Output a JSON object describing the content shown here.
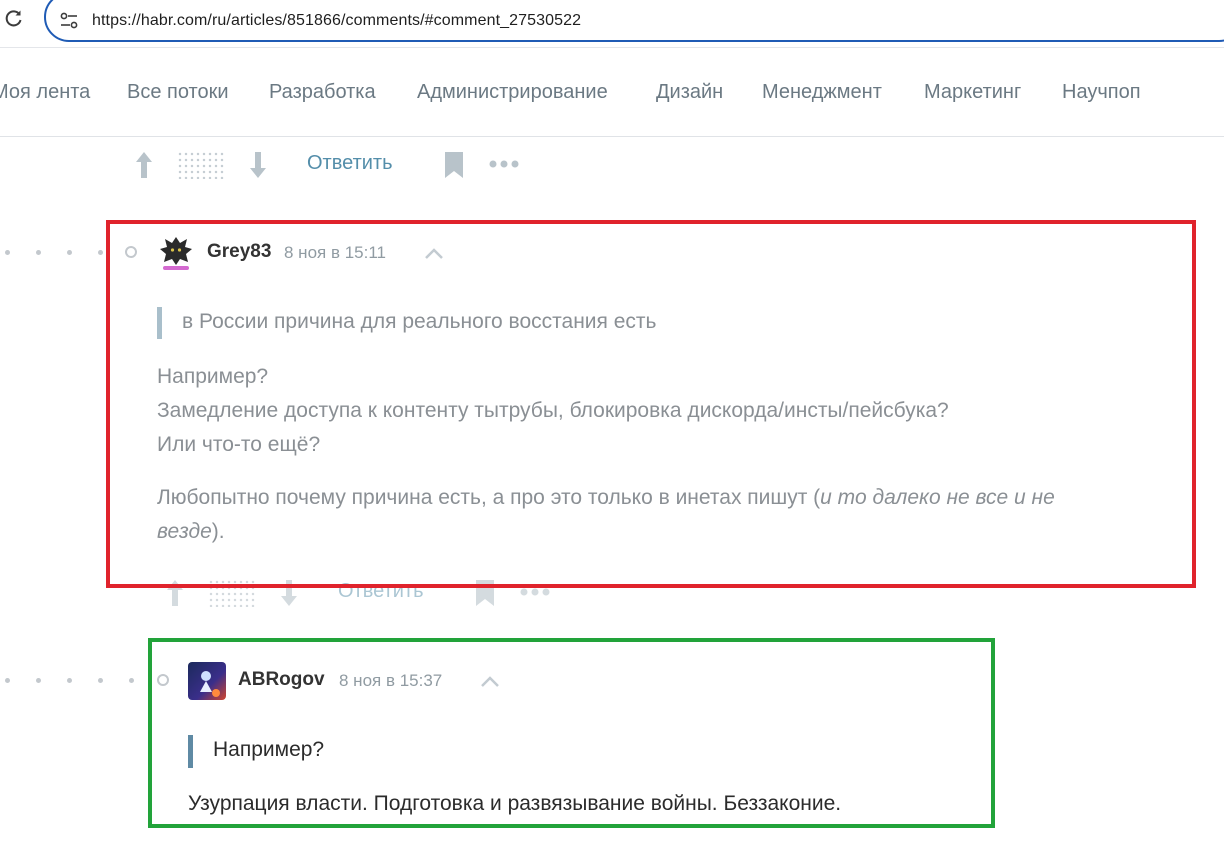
{
  "browser": {
    "url": "https://habr.com/ru/articles/851866/comments/#comment_27530522",
    "icons": {
      "reload": "reload-icon",
      "site_info": "site-info-icon"
    }
  },
  "nav": {
    "items": [
      "Моя лента",
      "Все потоки",
      "Разработка",
      "Администрирование",
      "Дизайн",
      "Менеджмент",
      "Маркетинг",
      "Научпоп"
    ]
  },
  "actions": {
    "reply_label": "Ответить",
    "icons": [
      "arrow-up-icon",
      "arrow-down-icon",
      "bookmark-icon",
      "more-icon"
    ]
  },
  "comments": [
    {
      "username": "Grey83",
      "date": "8 ноя в 15:11",
      "quote": "в России причина для реального восстания есть",
      "lines": [
        "Например?",
        "Замедление доступа к контенту тытрубы, блокировка дискорда/инсты/пейсбука?",
        "Или что-то ещё?"
      ],
      "paragraph": {
        "before": "Любопытно почему причина есть, а про это только в инетах пишут (",
        "italic_1": "и то далеко не все и не",
        "italic_2": "везде",
        "after": ")."
      }
    },
    {
      "username": "ABRogov",
      "date": "8 ноя в 15:37",
      "quote": "Например?",
      "text": "Узурпация власти. Подготовка и развязывание войны. Беззаконие."
    }
  ],
  "colors": {
    "nav_text": "#6b7983",
    "reply_link": "#548eaa",
    "highlight_red": "#e0232c",
    "highlight_green": "#22a33a",
    "url_border": "#1f5bb5"
  }
}
